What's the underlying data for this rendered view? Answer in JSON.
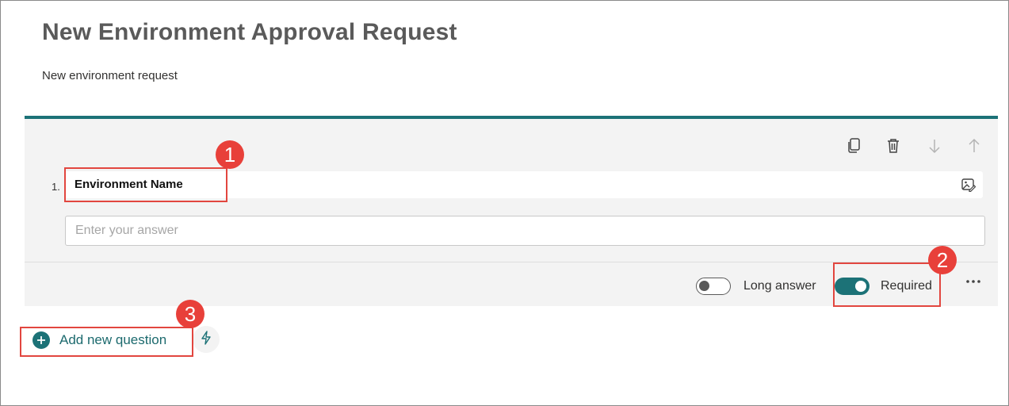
{
  "form": {
    "title": "New Environment Approval Request",
    "subtitle": "New environment request"
  },
  "question": {
    "number": "1.",
    "title": "Environment Name",
    "answer_placeholder": "Enter your answer",
    "long_answer_label": "Long answer",
    "long_answer_enabled": false,
    "required_label": "Required",
    "required_enabled": true
  },
  "toolbar": {
    "icons": [
      "copy-icon",
      "delete-icon",
      "move-down-icon",
      "move-up-icon"
    ],
    "more_icon": "more-options-icon"
  },
  "add_question": {
    "label": "Add new question",
    "quick_icon": "lightning-icon"
  },
  "callouts": [
    "1",
    "2",
    "3"
  ],
  "colors": {
    "accent": "#1c7277",
    "callout": "#e2463f"
  }
}
